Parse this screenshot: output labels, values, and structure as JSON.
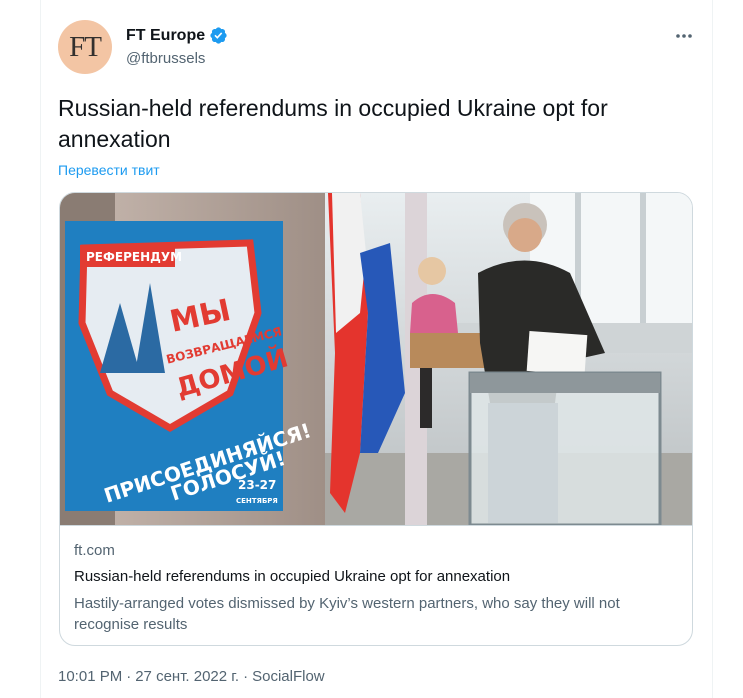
{
  "tweet": {
    "author": {
      "avatar_text": "FT",
      "display_name": "FT Europe",
      "handle": "@ftbrussels",
      "verified": true
    },
    "text": "Russian-held referendums in occupied Ukraine opt for annexation",
    "translate_label": "Перевести твит",
    "card": {
      "domain": "ft.com",
      "title": "Russian-held referendums in occupied Ukraine opt for annexation",
      "description": "Hastily-arranged votes dismissed by Kyiv’s western partners, who say they will not recognise results",
      "image": {
        "poster_banner": "РЕФЕРЕНДУМ",
        "poster_line1": "МЫ",
        "poster_line2": "ВОЗВРАЩАЕМСЯ",
        "poster_line3": "ДОМОЙ",
        "poster_line4": "ПРИСОЕДИНЯЙСЯ!",
        "poster_line5": "ГОЛОСУЙ!",
        "poster_dates": "23-27",
        "poster_month": "СЕНТЯБРЯ"
      }
    },
    "time": "10:01 PM",
    "date": "27 сент. 2022 г.",
    "source": "SocialFlow",
    "separator": "·"
  },
  "colors": {
    "link": "#1d9bf0",
    "text": "#0f1419",
    "secondary": "#536471",
    "border": "#cfd9de",
    "avatar_bg": "#f3c5a4"
  }
}
